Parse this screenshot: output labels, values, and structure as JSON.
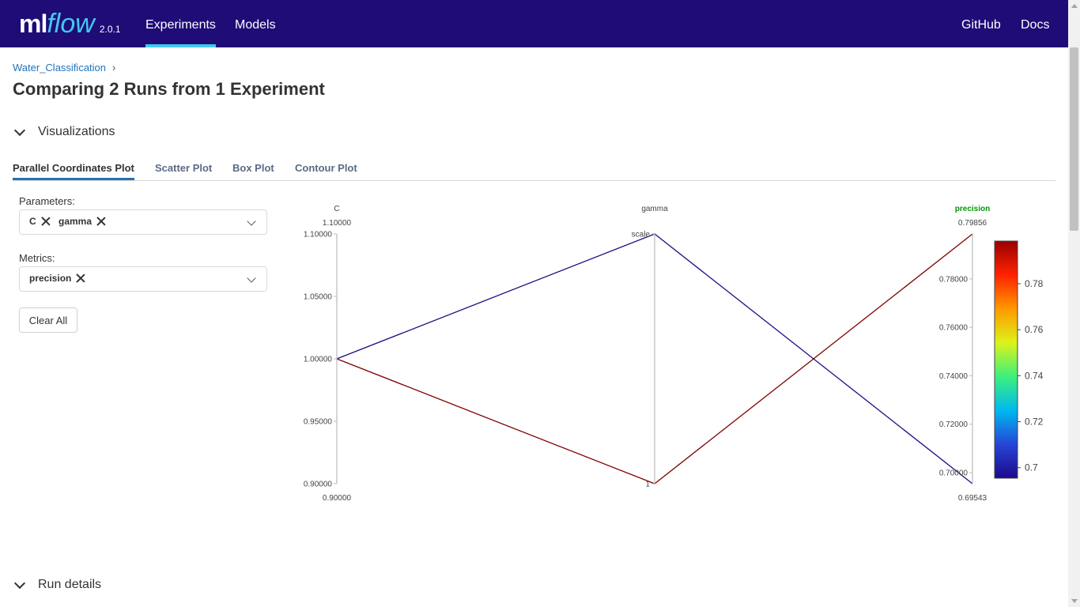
{
  "header": {
    "logo_ml": "ml",
    "logo_flow": "flow",
    "version": "2.0.1",
    "nav": [
      {
        "label": "Experiments",
        "active": true
      },
      {
        "label": "Models",
        "active": false
      }
    ],
    "right_links": [
      "GitHub",
      "Docs"
    ],
    "background_color": "#1f0c77",
    "accent_color": "#43c9ed"
  },
  "breadcrumb": {
    "experiment": "Water_Classification",
    "separator": "›"
  },
  "page_title": "Comparing 2 Runs from 1 Experiment",
  "visualizations": {
    "section_title": "Visualizations",
    "tabs": [
      {
        "label": "Parallel Coordinates Plot",
        "active": true
      },
      {
        "label": "Scatter Plot",
        "active": false
      },
      {
        "label": "Box Plot",
        "active": false
      },
      {
        "label": "Contour Plot",
        "active": false
      }
    ],
    "parameters_label": "Parameters:",
    "parameters_selected": [
      "C",
      "gamma"
    ],
    "metrics_label": "Metrics:",
    "metrics_selected": [
      "precision"
    ],
    "clear_all_label": "Clear All"
  },
  "chart_data": {
    "type": "parallel_coordinates",
    "axes": [
      {
        "name": "C",
        "kind": "numeric",
        "range": [
          0.9,
          1.1
        ],
        "top_label": "1.10000",
        "bottom_label": "0.90000",
        "ticks": [
          "1.10000",
          "1.05000",
          "1.00000",
          "0.95000",
          "0.90000"
        ],
        "tick_values": [
          1.1,
          1.05,
          1.0,
          0.95,
          0.9
        ]
      },
      {
        "name": "gamma",
        "kind": "categorical",
        "categories": [
          "scale",
          "1"
        ]
      },
      {
        "name": "precision",
        "kind": "numeric",
        "range": [
          0.69543,
          0.79856
        ],
        "highlight_color": "#009900",
        "top_label": "0.79856",
        "bottom_label": "0.69543",
        "ticks": [
          "0.78000",
          "0.76000",
          "0.74000",
          "0.72000",
          "0.70000"
        ],
        "tick_values": [
          0.78,
          0.76,
          0.74,
          0.72,
          0.7
        ]
      }
    ],
    "runs": [
      {
        "C": 1.0,
        "gamma": "scale",
        "precision": 0.69543,
        "color": "#1c0f84"
      },
      {
        "C": 1.0,
        "gamma": "1",
        "precision": 0.79856,
        "color": "#7f0000"
      }
    ],
    "colorbar": {
      "range": [
        0.69543,
        0.79856
      ],
      "ticks": [
        "0.78",
        "0.76",
        "0.74",
        "0.72",
        "0.7"
      ],
      "tick_values": [
        0.78,
        0.76,
        0.74,
        0.72,
        0.7
      ],
      "colorscale": [
        "#1d0a8c",
        "#2545d6",
        "#00b9f0",
        "#3cf07c",
        "#ddf21a",
        "#ff9900",
        "#ff2200",
        "#990000"
      ]
    }
  },
  "run_details": {
    "section_title": "Run details"
  }
}
